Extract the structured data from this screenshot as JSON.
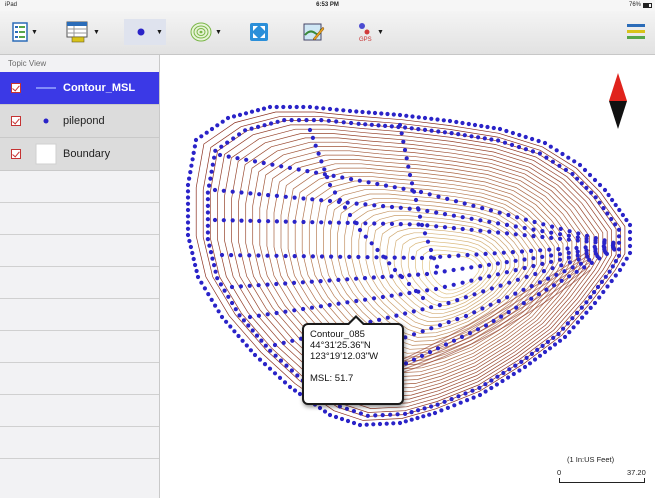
{
  "status_bar": {
    "device": "iPad",
    "time": "6:53 PM",
    "battery": "76%"
  },
  "toolbar": {
    "buttons": [
      {
        "name": "layers-list-button",
        "icon": "layer-list-icon"
      },
      {
        "name": "data-table-button",
        "icon": "table-icon"
      },
      {
        "name": "point-style-button",
        "icon": "blue-dot-icon"
      },
      {
        "name": "contour-button",
        "icon": "contour-icon"
      },
      {
        "name": "zoom-extent-button",
        "icon": "fullscreen-icon"
      },
      {
        "name": "map-tools-button",
        "icon": "map-edit-icon"
      },
      {
        "name": "gps-button",
        "icon": "gps-icon"
      },
      {
        "name": "settings-button",
        "icon": "settings-icon"
      }
    ]
  },
  "sidebar": {
    "header": "Topic View",
    "layers": [
      {
        "label": "Contour_MSL",
        "checked": true,
        "selected": true,
        "symbol": "line"
      },
      {
        "label": "pilepond",
        "checked": true,
        "selected": false,
        "symbol": "dot"
      },
      {
        "label": "Boundary",
        "checked": true,
        "selected": false,
        "symbol": "polygon"
      }
    ]
  },
  "callout": {
    "name": "Contour_085",
    "lat": "44°31'25.36\"N",
    "lon": "123°19'12.03\"W",
    "msl": "MSL: 51.7"
  },
  "scale": {
    "units": "(1 In:US Feet)",
    "min": "0",
    "max": "37.20"
  },
  "colors": {
    "selection": "#3b39e6",
    "points": "#2a23c8",
    "contour_dark": "#8a2f1e",
    "contour_light": "#e3c98a",
    "north_up": "#e0231c",
    "north_down": "#111111"
  }
}
